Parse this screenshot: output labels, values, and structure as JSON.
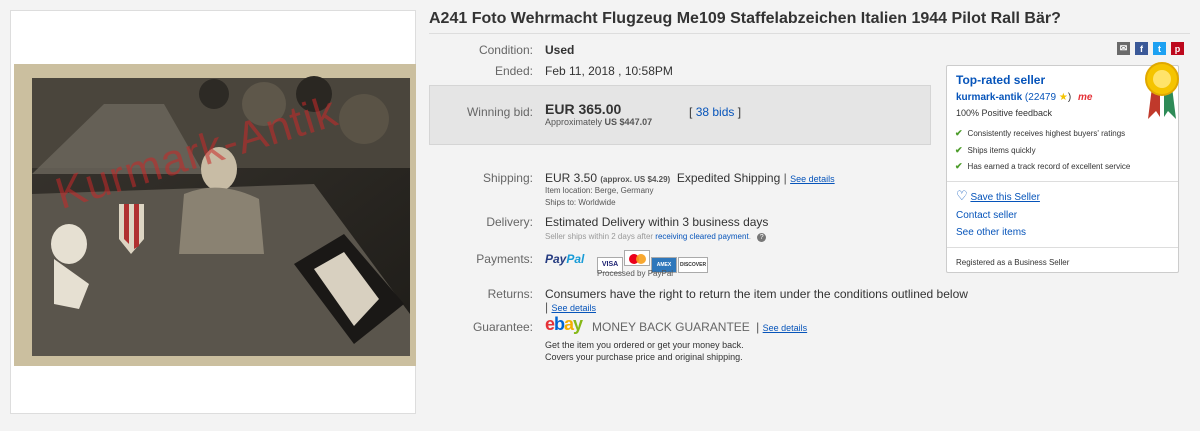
{
  "listing": {
    "title": "A241 Foto Wehrmacht Flugzeug Me109 Staffelabzeichen Italien 1944 Pilot Rall Bär?",
    "photo_watermark": "Kurmark-Antik"
  },
  "details": {
    "condition_label": "Condition:",
    "condition_value": "Used",
    "ended_label": "Ended:",
    "ended_value": "Feb 11, 2018 , 10:58PM"
  },
  "bid": {
    "label": "Winning bid:",
    "amount": "EUR 365.00",
    "approx_prefix": "Approximately",
    "approx_value": "US $447.07",
    "bids_open": "[",
    "bids_link": "38 bids",
    "bids_close": "]"
  },
  "shipping": {
    "label": "Shipping:",
    "cost": "EUR 3.50",
    "approx": "(approx. US $4.29)",
    "method": "Expedited Shipping",
    "see_details": "See details",
    "item_location": "Item location:  Berge, Germany",
    "ships_to": "Ships to:  Worldwide"
  },
  "delivery": {
    "label": "Delivery:",
    "value": "Estimated Delivery within 3 business days",
    "note_prefix": "Seller ships within 2 days after",
    "note_link": "receiving cleared payment",
    "note_suffix": "."
  },
  "payments": {
    "label": "Payments:",
    "paypal_pay": "Pay",
    "paypal_pal": "Pal",
    "processed": "Processed by PayPal",
    "cards": [
      "VISA",
      "MC",
      "AMEX",
      "DISCOVER"
    ]
  },
  "returns": {
    "label": "Returns:",
    "value": "Consumers have the right to return the item under the conditions outlined below",
    "see_details": "See details"
  },
  "guarantee": {
    "label": "Guarantee:",
    "ebay_letters": [
      "e",
      "b",
      "a",
      "y"
    ],
    "ebay_colors": [
      "#e53238",
      "#0064d2",
      "#f5af02",
      "#86b817"
    ],
    "title": "MONEY BACK GUARANTEE",
    "see_details": "See details",
    "line1": "Get the item you ordered or get your money back.",
    "line2": "Covers your purchase price and original shipping."
  },
  "seller": {
    "heading": "Top-rated seller",
    "name": "kurmark-antik",
    "feedback_score": "(22479",
    "feedback_close": ")",
    "me_badge": "me",
    "positive": "100% Positive feedback",
    "bullets": [
      "Consistently receives highest buyers' ratings",
      "Ships items quickly",
      "Has earned a track record of excellent service"
    ],
    "save_seller": "Save this Seller",
    "contact": "Contact seller",
    "other_items": "See other items",
    "registered": "Registered as a Business Seller"
  },
  "share_icons": [
    "email-icon",
    "facebook-icon",
    "twitter-icon",
    "pinterest-icon"
  ],
  "colors": {
    "link": "#0654ba",
    "paypal_dark": "#253b80",
    "paypal_light": "#179bd7",
    "check": "#4c9c2a"
  }
}
